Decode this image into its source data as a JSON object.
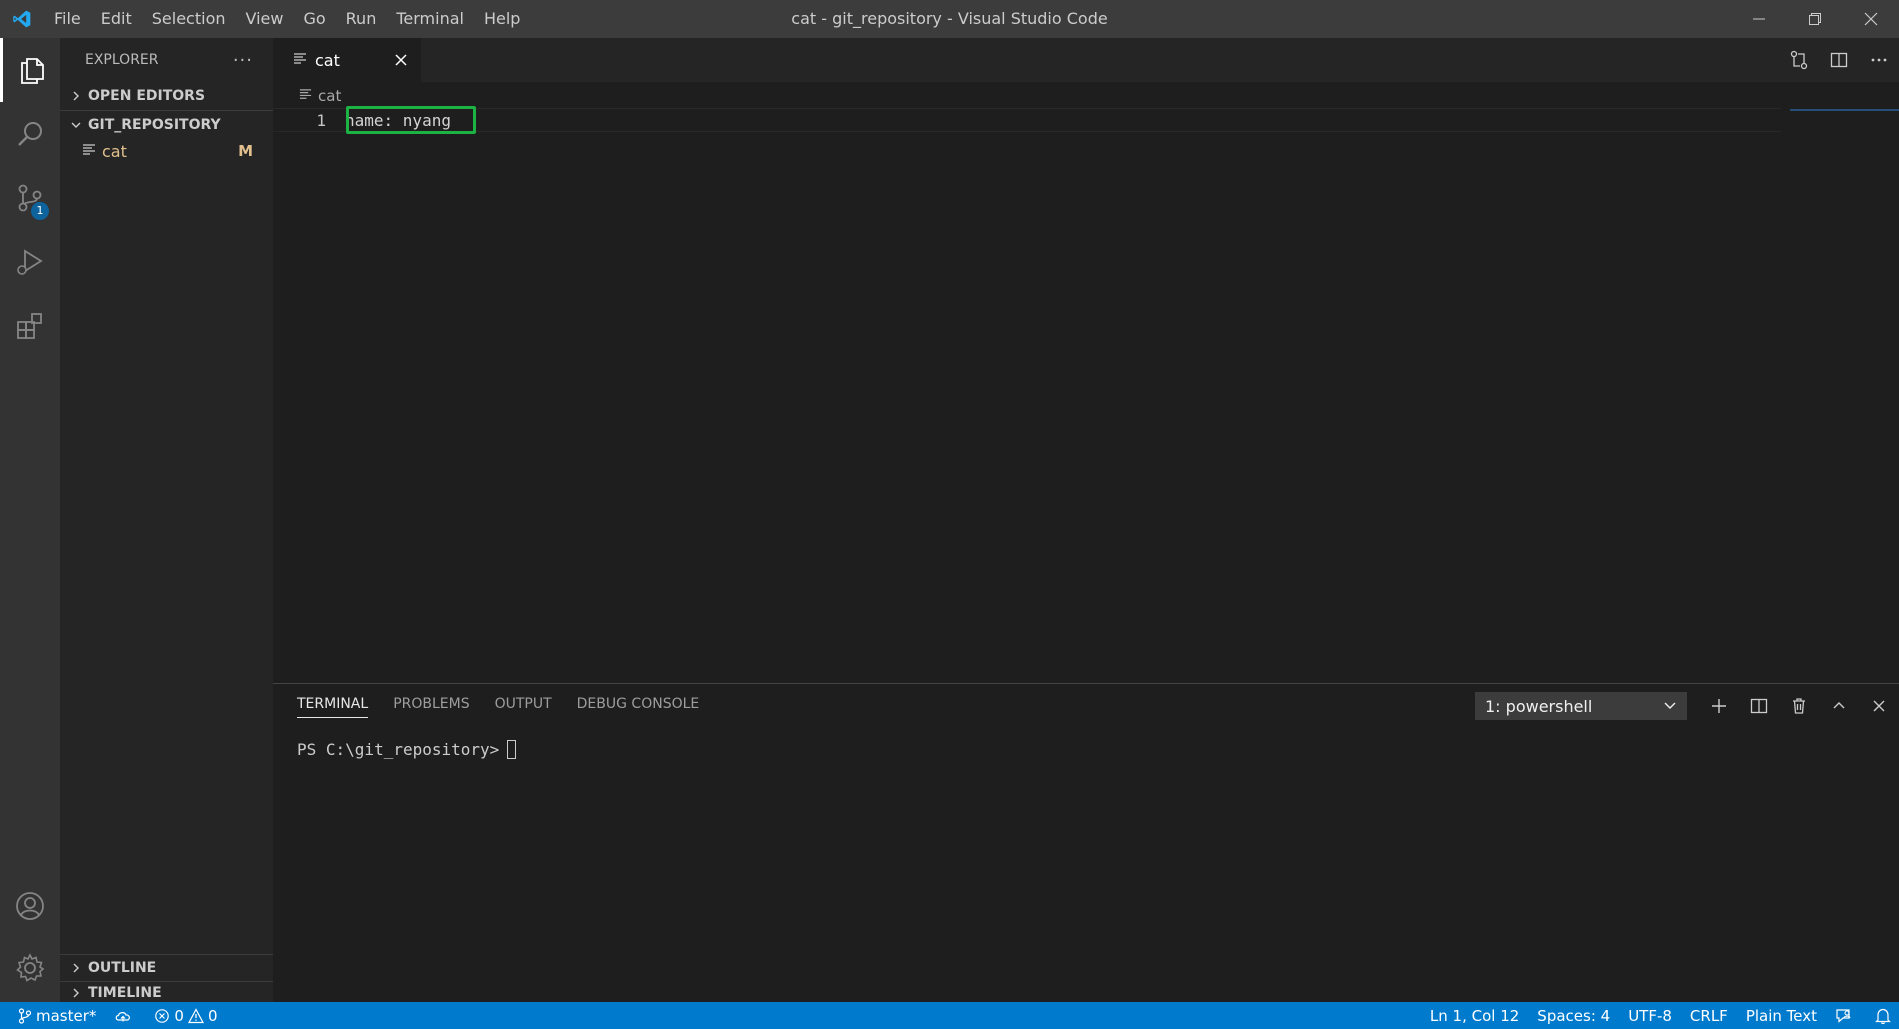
{
  "window": {
    "title": "cat - git_repository - Visual Studio Code",
    "menu": [
      "File",
      "Edit",
      "Selection",
      "View",
      "Go",
      "Run",
      "Terminal",
      "Help"
    ]
  },
  "activity": {
    "scm_badge": "1"
  },
  "sidebar": {
    "title": "EXPLORER",
    "more": "···",
    "sections": {
      "open_editors": "OPEN EDITORS",
      "repo": "GIT_REPOSITORY",
      "outline": "OUTLINE",
      "timeline": "TIMELINE"
    },
    "files": [
      {
        "name": "cat",
        "status": "M"
      }
    ]
  },
  "editor": {
    "tab_label": "cat",
    "breadcrumb": "cat",
    "lines": [
      {
        "number": "1",
        "text": "name: nyang"
      }
    ]
  },
  "panel": {
    "tabs": [
      "TERMINAL",
      "PROBLEMS",
      "OUTPUT",
      "DEBUG CONSOLE"
    ],
    "terminal_select": "1: powershell",
    "prompt": "PS C:\\git_repository>"
  },
  "statusbar": {
    "branch": "master*",
    "errors": "0",
    "warnings": "0",
    "position": "Ln 1, Col 12",
    "spaces": "Spaces: 4",
    "encoding": "UTF-8",
    "eol": "CRLF",
    "language": "Plain Text"
  },
  "colors": {
    "accent": "#007acc",
    "highlight": "#1db244",
    "modified": "#e2c08d"
  }
}
